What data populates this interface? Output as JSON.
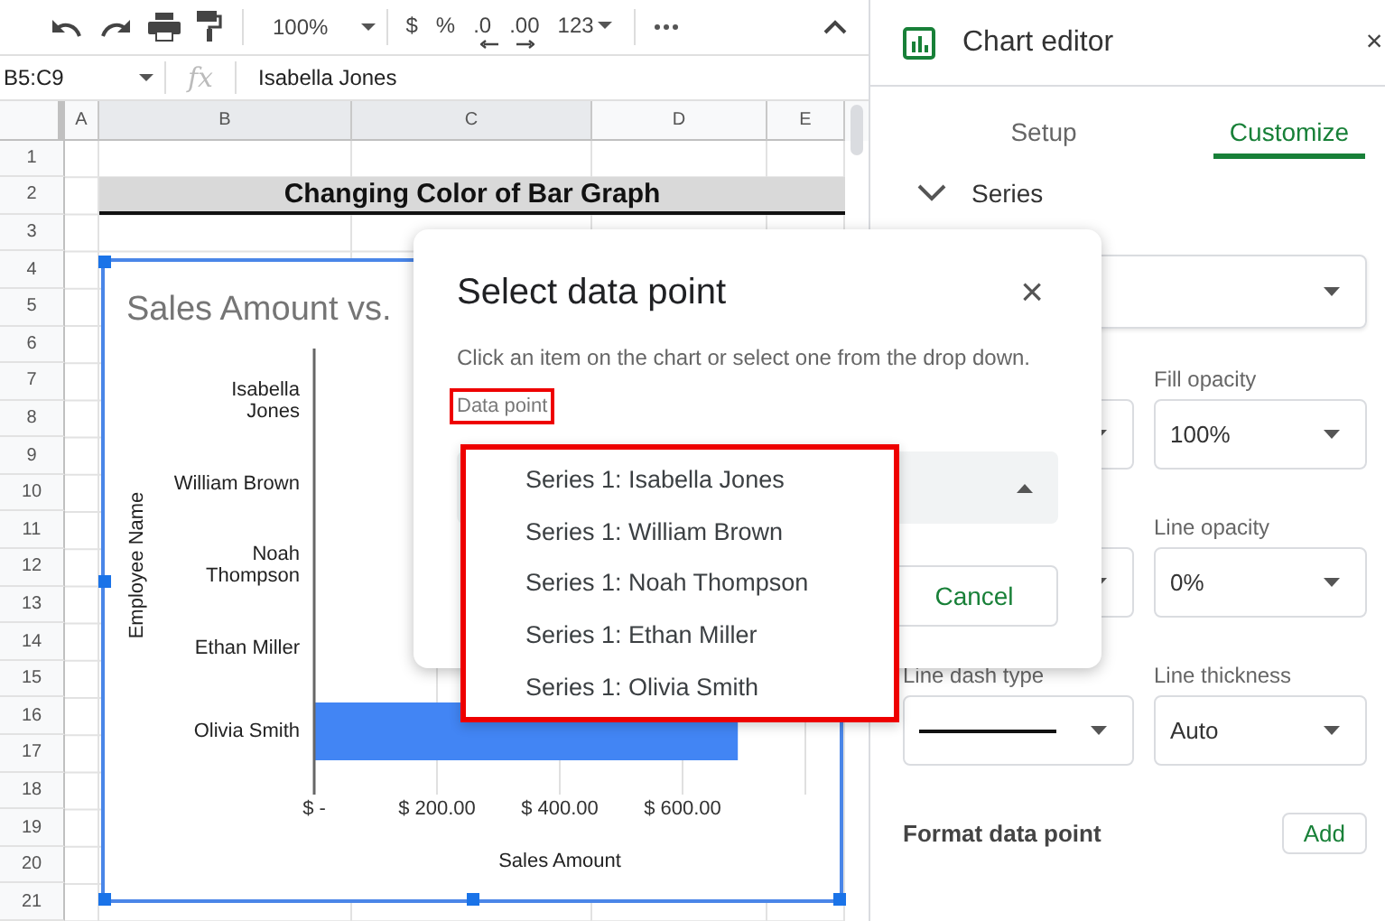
{
  "toolbar": {
    "zoom": "100%",
    "format_buttons": [
      {
        "label": "$",
        "kind": "plain"
      },
      {
        "label": "%",
        "kind": "plain"
      },
      {
        "label": ".0",
        "kind": "arrow-left"
      },
      {
        "label": ".00",
        "kind": "arrow-right"
      },
      {
        "label": "123",
        "kind": "menu"
      }
    ]
  },
  "formula_bar": {
    "name_box": "B5:C9",
    "fx": "fx",
    "value": "Isabella Jones"
  },
  "columns": [
    "A",
    "B",
    "C",
    "D",
    "E"
  ],
  "rows": [
    "1",
    "2",
    "3",
    "4",
    "5",
    "6",
    "7",
    "8",
    "9",
    "10",
    "11",
    "12",
    "13",
    "14",
    "15",
    "16",
    "17",
    "18",
    "19",
    "20",
    "21"
  ],
  "sheet_title": "Changing Color of Bar Graph",
  "chart": {
    "selected": true,
    "chart_data": {
      "type": "bar",
      "orientation": "horizontal",
      "title": "Sales Amount vs.",
      "xlabel": "Sales Amount",
      "ylabel": "Employee Name",
      "categories": [
        "Isabella Jones",
        "William Brown",
        "Noah Thompson",
        "Ethan Miller",
        "Olivia Smith"
      ],
      "series": [
        {
          "color": "#4285f4",
          "values": [
            null,
            null,
            null,
            null,
            690
          ]
        }
      ],
      "grid": true,
      "xlim": [
        0,
        800
      ],
      "xticks": [
        {
          "value": 0,
          "label": "$ -"
        },
        {
          "value": 200,
          "label": "$ 200.00"
        },
        {
          "value": 400,
          "label": "$ 400.00"
        },
        {
          "value": 600,
          "label": "$ 600.00"
        }
      ]
    }
  },
  "editor": {
    "title": "Chart editor",
    "close": "×",
    "tabs": [
      {
        "label": "Setup",
        "selected": false
      },
      {
        "label": "Customize",
        "selected": true
      }
    ],
    "section": {
      "label": "Series",
      "expanded": true
    },
    "fields": [
      {
        "kind": "select"
      },
      {
        "kind": "select",
        "label": "Fill opacity",
        "value": "100%"
      },
      {
        "kind": "select"
      },
      {
        "kind": "select",
        "label": "Line opacity",
        "value": "0%"
      },
      {
        "kind": "line",
        "label": "Line dash type"
      },
      {
        "kind": "select",
        "label": "Line thickness",
        "value": "Auto"
      }
    ],
    "format_label": "Format data point",
    "add_button": "Add"
  },
  "dialog": {
    "title": "Select data point",
    "close": "×",
    "description": "Click an item on the chart or select one from the drop down.",
    "field_label": "Data point",
    "label_highlighted": true,
    "field_expanded": true,
    "cancel": "Cancel",
    "menu": {
      "highlighted": true,
      "items": [
        "Series 1: Isabella Jones",
        "Series 1: William Brown",
        "Series 1: Noah Thompson",
        "Series 1: Ethan Miller",
        "Series 1: Olivia Smith"
      ]
    }
  }
}
